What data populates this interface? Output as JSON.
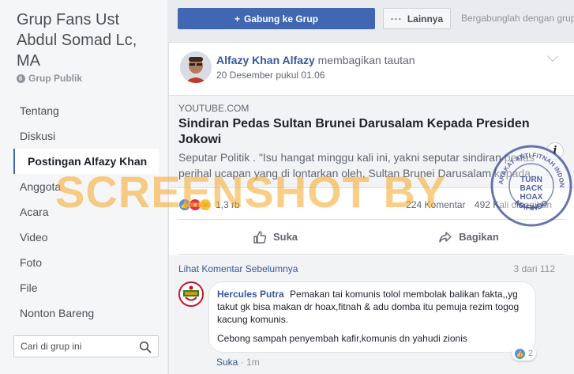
{
  "sidebar": {
    "group_name": "Grup Fans Ust Abdul Somad Lc, MA",
    "group_type": "Grup Publik",
    "nav": [
      "Tentang",
      "Diskusi",
      "Postingan Alfazy Khan",
      "Anggota",
      "Acara",
      "Video",
      "Foto",
      "File",
      "Nonton Bareng"
    ],
    "search_placeholder": "Cari di grup ini"
  },
  "topbar": {
    "join_label": "Gabung ke Grup",
    "more_label": "Lainnya",
    "join_hint": "Bergabunglah dengan grup"
  },
  "post": {
    "author": "Alfazy Khan Alfazy",
    "action": "membagikan tautan",
    "time": "20 Desember pukul 01.06",
    "link": {
      "domain": "YOUTUBE.COM",
      "title": "Sindiran Pedas Sultan Brunei Darusalam Kepada Presiden Jokowi",
      "description": "Seputar Politik . \"Isu hangat minggu kali ini, yakni seputar sindiran pedas perihal ucapan yang di lontarkan oleh, Sultan Brunei Darusalam kepada..."
    },
    "reaction_count": "1,3 rb",
    "comments_stat": "224 Komentar",
    "shares_stat": "492 Kali dibagikan",
    "like_action": "Suka",
    "share_action": "Bagikan"
  },
  "comments": {
    "view_previous": "Lihat Komentar Sebelumnya",
    "count": "3 dari 112",
    "items": [
      {
        "author": "Hercules Putra",
        "text1": "Pemakan tai komunis tolol membolak balikan fakta,,yg takut gk bisa makan dr hoax,fitnah & adu domba itu pemuja rezim togog kacung komunis.",
        "text2": "Cebong sampah penyembah kafir,komunis dn yahudi zionis",
        "reactions": "2",
        "like_link": "Suka",
        "time": "1m"
      }
    ]
  },
  "watermark": {
    "text": "SCREENSHOT BY",
    "seal_top": "MASYARAKAT ANTI FITNAH INDONESIA",
    "seal_center": [
      "TURN",
      "BACK",
      "HOAX"
    ],
    "seal_bottom": "MAFINDO"
  },
  "colors": {
    "brand_blue": "#4267b2",
    "link_blue": "#365899",
    "watermark_orange": "#f5a623",
    "seal_blue": "#2b3a8c"
  }
}
